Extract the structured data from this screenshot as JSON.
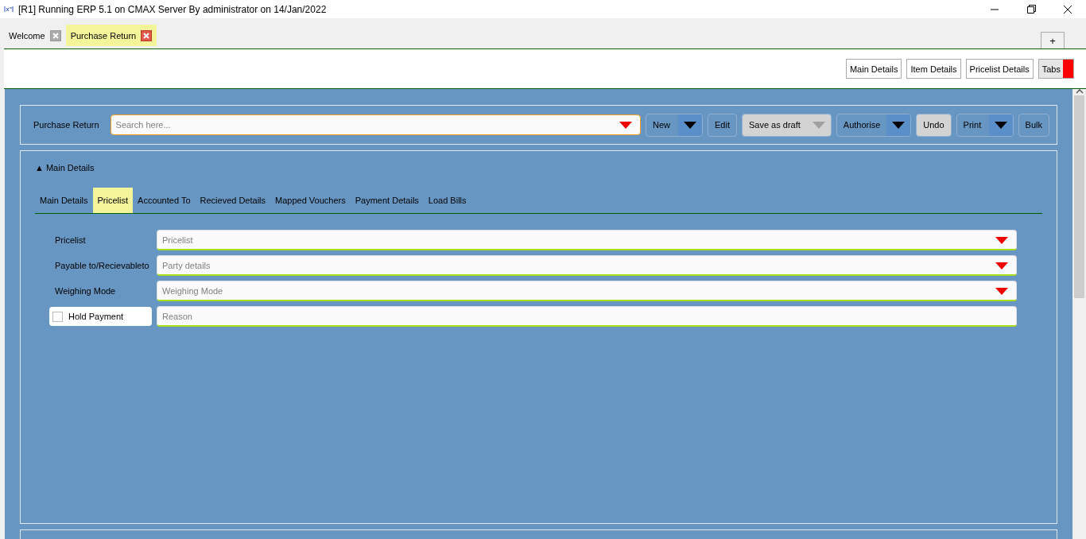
{
  "window": {
    "title": "[R1] Running ERP 5.1 on CMAX Server By administrator on 14/Jan/2022"
  },
  "doc_tabs": [
    {
      "label": "Welcome",
      "selected": false
    },
    {
      "label": "Purchase Return",
      "selected": true
    }
  ],
  "new_tab_button": "+",
  "section_links": [
    {
      "label": "Main Details",
      "kind": "plain"
    },
    {
      "label": "Item Details",
      "kind": "plain"
    },
    {
      "label": "Pricelist Details",
      "kind": "plain"
    },
    {
      "label": "Tabs",
      "kind": "flagged"
    }
  ],
  "toolbar": {
    "label": "Purchase Return",
    "search": {
      "placeholder": "Search here..."
    },
    "buttons": [
      {
        "label": "New",
        "kind": "split",
        "disabled": false
      },
      {
        "label": "Edit",
        "kind": "plain",
        "disabled": false
      },
      {
        "label": "Save as draft",
        "kind": "split",
        "disabled": true
      },
      {
        "label": "Authorise",
        "kind": "split",
        "disabled": false
      },
      {
        "label": "Undo",
        "kind": "plain",
        "disabled": true
      },
      {
        "label": "Print",
        "kind": "split",
        "disabled": false
      },
      {
        "label": "Bulk",
        "kind": "plain",
        "disabled": false
      }
    ]
  },
  "main_details": {
    "header": "▲ Main Details",
    "expanded": true,
    "tabs": [
      {
        "label": "Main Details",
        "selected": false
      },
      {
        "label": "Pricelist",
        "selected": true
      },
      {
        "label": "Accounted To",
        "selected": false
      },
      {
        "label": "Recieved Details",
        "selected": false
      },
      {
        "label": "Mapped Vouchers",
        "selected": false
      },
      {
        "label": "Payment Details",
        "selected": false
      },
      {
        "label": "Load Bills",
        "selected": false
      }
    ],
    "fields": [
      {
        "kind": "dropdown",
        "label": "Pricelist",
        "placeholder": "Pricelist"
      },
      {
        "kind": "dropdown",
        "label": "Payable to/Recievableto",
        "placeholder": "Party details"
      },
      {
        "kind": "dropdown",
        "label": "Weighing Mode",
        "placeholder": "Weighing Mode"
      },
      {
        "kind": "checkbox",
        "label": "Hold Payment",
        "checked": false,
        "placeholder": "Reason"
      }
    ]
  }
}
